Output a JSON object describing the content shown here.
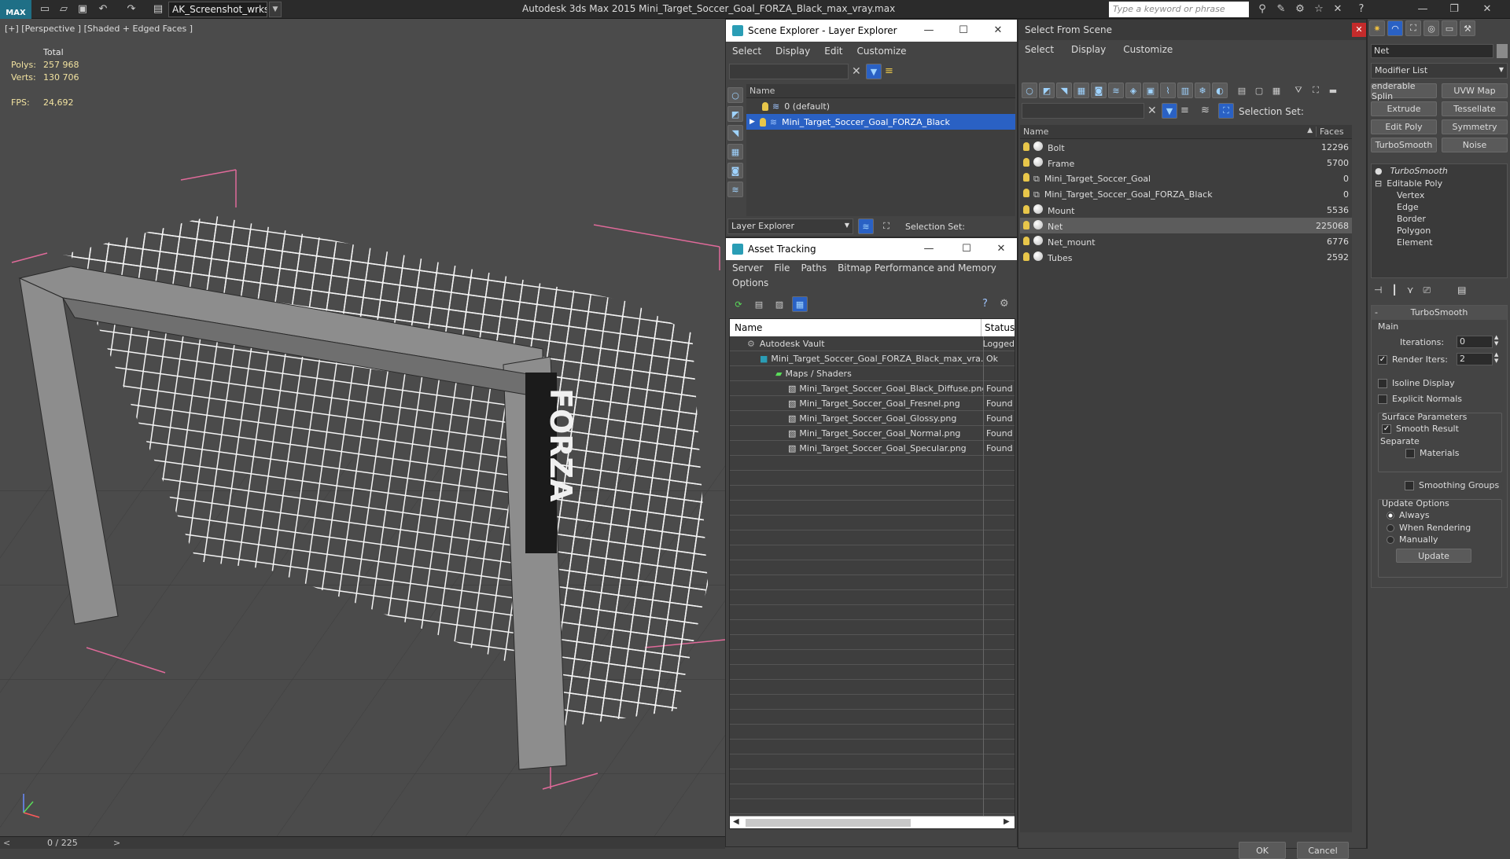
{
  "app": {
    "workspace": "AK_Screenshot_wrksp",
    "title": "Autodesk 3ds Max  2015     Mini_Target_Soccer_Goal_FORZA_Black_max_vray.max",
    "search_placeholder": "Type a keyword or phrase",
    "logo": "MAX"
  },
  "viewport": {
    "label": "[+] [Perspective ] [Shaded + Edged Faces ]",
    "stats": {
      "total": "Total",
      "polys_label": "Polys:",
      "polys": "257 968",
      "verts_label": "Verts:",
      "verts": "130 706",
      "fps_label": "FPS:",
      "fps": "24,692"
    },
    "brand": "FORZA",
    "timeline": "0 / 225"
  },
  "scene_explorer": {
    "title": "Scene Explorer - Layer Explorer",
    "menu": [
      "Select",
      "Display",
      "Edit",
      "Customize"
    ],
    "col_name": "Name",
    "rows": [
      "0 (default)",
      "Mini_Target_Soccer_Goal_FORZA_Black"
    ],
    "footer_mode": "Layer Explorer",
    "footer_selset": "Selection Set:"
  },
  "asset_tracking": {
    "title": "Asset Tracking",
    "menu": [
      "Server",
      "File",
      "Paths",
      "Bitmap Performance and Memory"
    ],
    "menu2": "Options",
    "col_name": "Name",
    "col_status": "Status",
    "rows": [
      {
        "name": "Autodesk Vault",
        "status": "Logged"
      },
      {
        "name": "Mini_Target_Soccer_Goal_FORZA_Black_max_vra...",
        "status": "Ok"
      },
      {
        "name": "Maps / Shaders",
        "status": ""
      },
      {
        "name": "Mini_Target_Soccer_Goal_Black_Diffuse.png",
        "status": "Found"
      },
      {
        "name": "Mini_Target_Soccer_Goal_Fresnel.png",
        "status": "Found"
      },
      {
        "name": "Mini_Target_Soccer_Goal_Glossy.png",
        "status": "Found"
      },
      {
        "name": "Mini_Target_Soccer_Goal_Normal.png",
        "status": "Found"
      },
      {
        "name": "Mini_Target_Soccer_Goal_Specular.png",
        "status": "Found"
      }
    ]
  },
  "select_from_scene": {
    "title": "Select From Scene",
    "menu": [
      "Select",
      "Display",
      "Customize"
    ],
    "selset": "Selection Set:",
    "col_name": "Name",
    "col_faces": "Faces",
    "rows": [
      {
        "name": "Bolt",
        "faces": "12296"
      },
      {
        "name": "Frame",
        "faces": "5700"
      },
      {
        "name": "Mini_Target_Soccer_Goal",
        "faces": "0"
      },
      {
        "name": "Mini_Target_Soccer_Goal_FORZA_Black",
        "faces": "0"
      },
      {
        "name": "Mount",
        "faces": "5536"
      },
      {
        "name": "Net",
        "faces": "225068"
      },
      {
        "name": "Net_mount",
        "faces": "6776"
      },
      {
        "name": "Tubes",
        "faces": "2592"
      }
    ],
    "ok": "OK",
    "cancel": "Cancel"
  },
  "command_panel": {
    "object_name": "Net",
    "modifier_list": "Modifier List",
    "buttons": [
      "enderable Splin",
      "UVW Map",
      "Extrude",
      "Tessellate",
      "Edit Poly",
      "Symmetry",
      "TurboSmooth",
      "Noise"
    ],
    "stack": [
      "TurboSmooth",
      "Editable Poly",
      "Vertex",
      "Edge",
      "Border",
      "Polygon",
      "Element"
    ],
    "rollout_title": "TurboSmooth",
    "main": "Main",
    "iterations_label": "Iterations:",
    "iterations": "0",
    "render_iters_label": "Render Iters:",
    "render_iters": "2",
    "isoline": "Isoline Display",
    "explicit": "Explicit Normals",
    "surface": "Surface Parameters",
    "smooth": "Smooth Result",
    "separate": "Separate",
    "materials": "Materials",
    "smoothing": "Smoothing Groups",
    "update_options": "Update Options",
    "always": "Always",
    "when_rendering": "When Rendering",
    "manually": "Manually",
    "update": "Update"
  }
}
